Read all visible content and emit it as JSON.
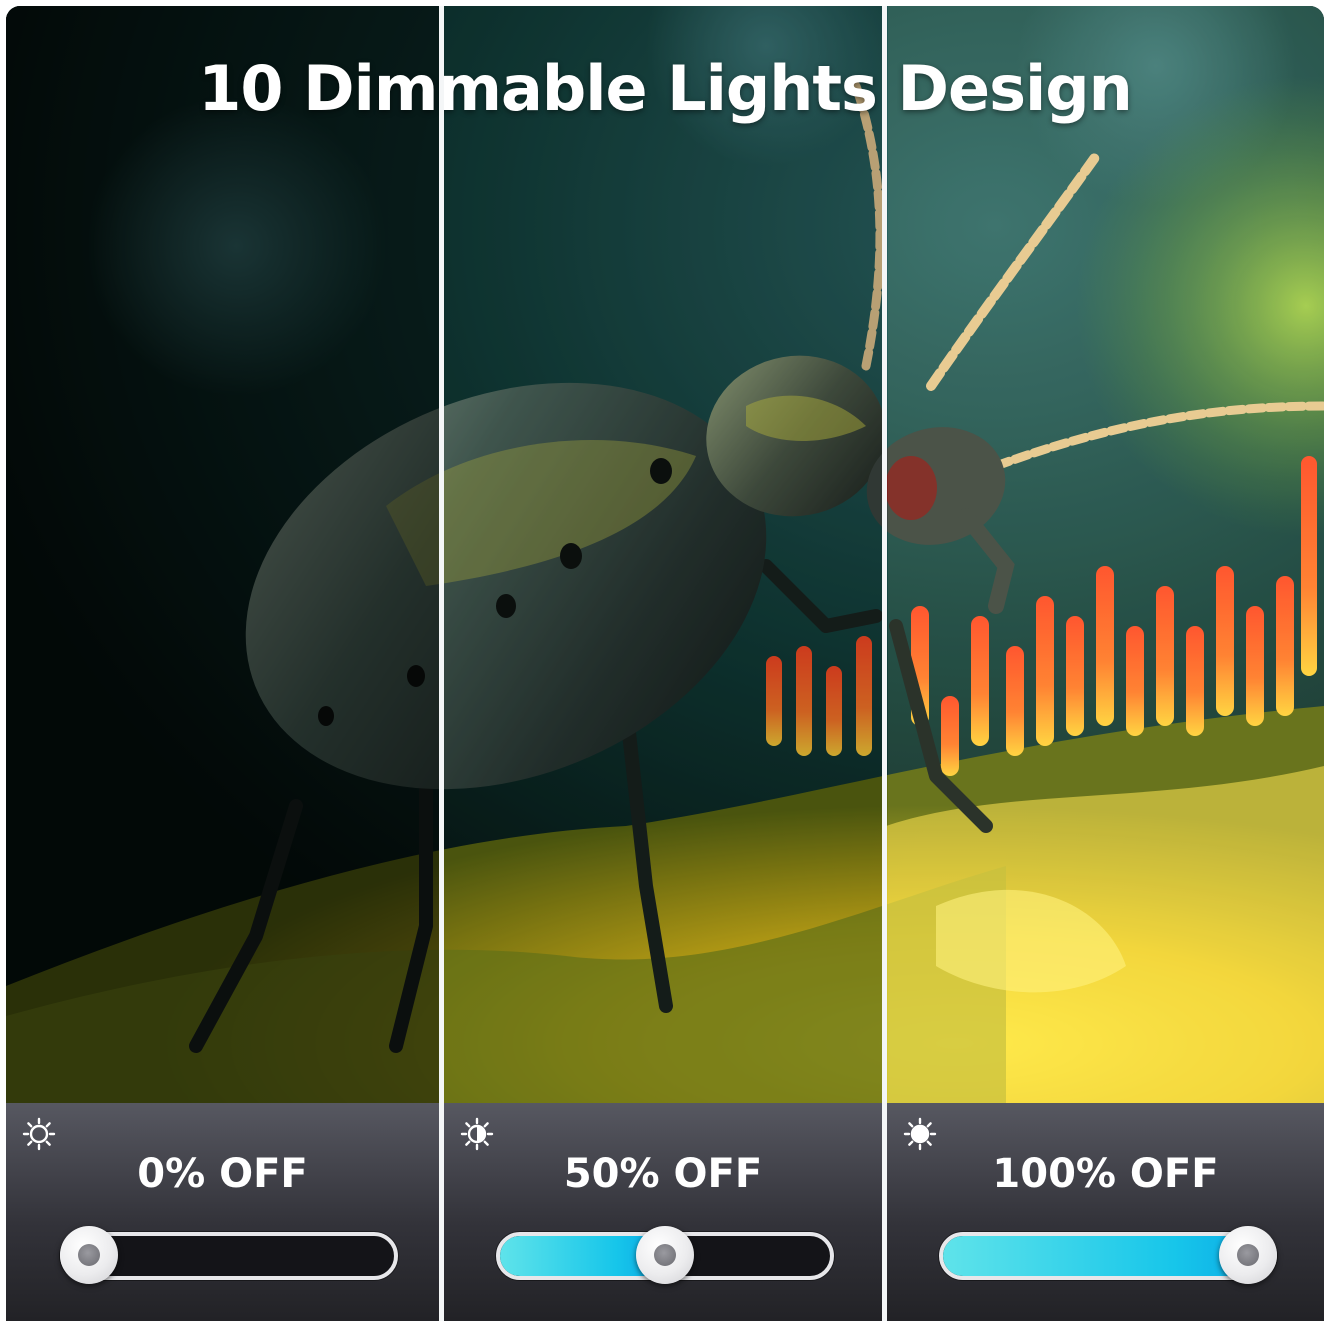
{
  "title": "10 Dimmable Lights Design",
  "panels": [
    {
      "label": "0% OFF",
      "icon": "sun-outline-icon",
      "level": 0
    },
    {
      "label": "50% OFF",
      "icon": "sun-half-icon",
      "level": 0.5
    },
    {
      "label": "100% OFF",
      "icon": "sun-filled-icon",
      "level": 1
    }
  ],
  "colors": {
    "slider_fill": "#17c6ea",
    "slider_track": "#141418",
    "panel_bg": "#3a3a41"
  },
  "image_subject": "macro photo of a beetle on a yellow flower with orange stamens"
}
